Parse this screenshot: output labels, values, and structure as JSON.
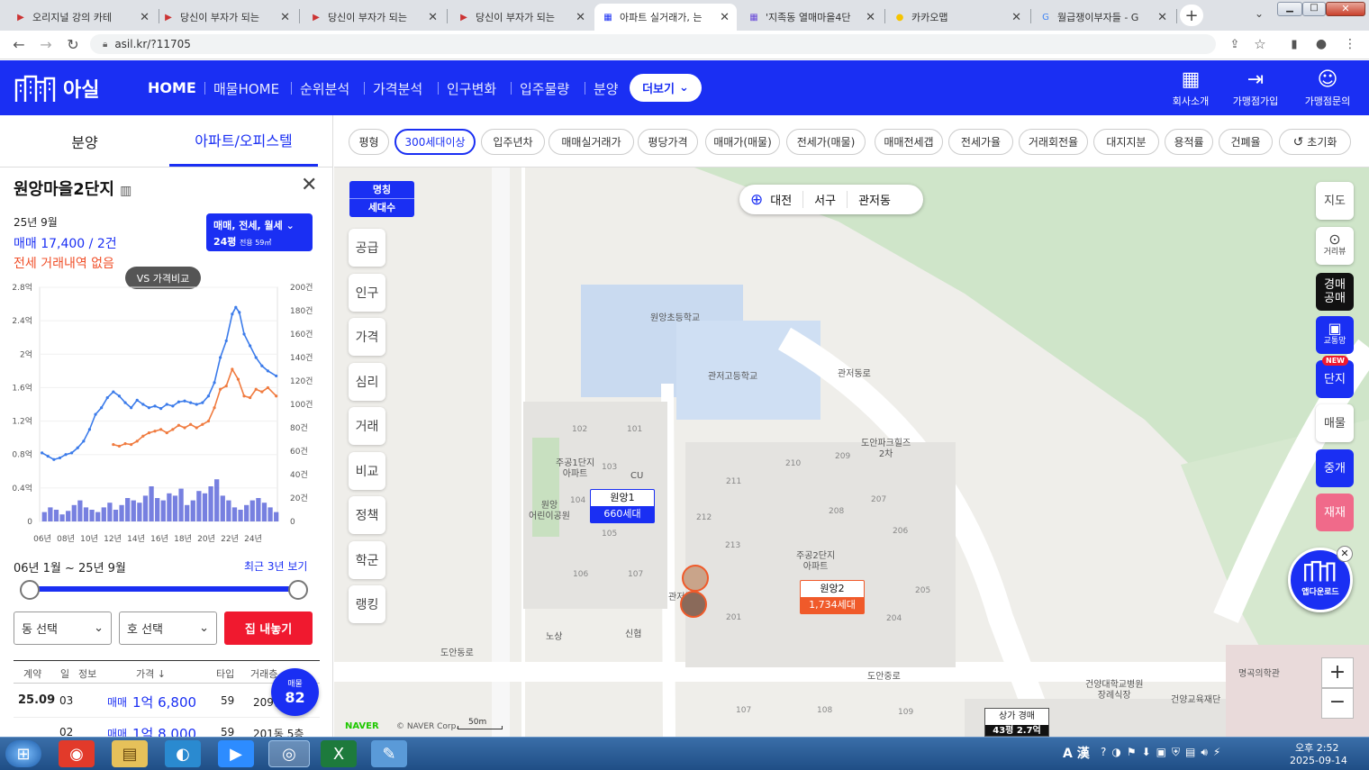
{
  "browser": {
    "tabs": [
      {
        "title": "오리지널 강의 카테",
        "icon": "flag"
      },
      {
        "title": "당신이 부자가 되는",
        "icon": "flag"
      },
      {
        "title": "당신이 부자가 되는",
        "icon": "flag"
      },
      {
        "title": "당신이 부자가 되는",
        "icon": "flag"
      },
      {
        "title": "아파트 실거래가, 는",
        "icon": "asil"
      },
      {
        "title": "'지족동 열매마을4단",
        "icon": "asil2"
      },
      {
        "title": "카카오맵",
        "icon": "kakao"
      },
      {
        "title": "월급쟁이부자들 - G",
        "icon": "google"
      }
    ],
    "url": "asil.kr/?11705"
  },
  "app": {
    "logo": "아실",
    "menu": [
      "HOME",
      "매물HOME",
      "순위분석",
      "가격분석",
      "인구변화",
      "입주물량",
      "분양"
    ],
    "more_btn": "더보기",
    "right_tools": [
      "회사소개",
      "가맹점가입",
      "가맹점문의"
    ]
  },
  "left": {
    "tabs": [
      "분양",
      "아파트/오피스텔"
    ],
    "apt_name": "원앙마을2단지",
    "date": "25년 9월",
    "sale_line": "매매 17,400 / 2건",
    "jeonse_line": "전세 거래내역 없음",
    "trade_box_title": "매매, 전세, 월세",
    "trade_box_size": "24평",
    "trade_box_sub": "전용 59㎡",
    "vs_btn": "VS 가격비교",
    "range_text": "06년 1월 ~ 25년 9월",
    "recent_link": "최근 3년 보기",
    "dong_select": "동 선택",
    "ho_select": "호 선택",
    "list_btn": "집 내놓기",
    "table_headers": [
      "계약",
      "일",
      "정보",
      "가격",
      "타입",
      "거래층"
    ],
    "rows": [
      {
        "ym": "25.09",
        "d": "03",
        "kind": "매매",
        "price": "1억 6,800",
        "type": "59",
        "floor": "209동"
      },
      {
        "ym": "",
        "d": "02",
        "kind": "매매",
        "price": "1억 8,000",
        "type": "59",
        "floor": "201동 5층"
      }
    ],
    "listing_badge_label": "매물",
    "listing_badge_count": "82"
  },
  "chart_data": {
    "type": "line",
    "x_ticks": [
      "06년",
      "08년",
      "10년",
      "12년",
      "14년",
      "16년",
      "18년",
      "20년",
      "22년",
      "24년"
    ],
    "y_left_ticks": [
      "2.8억",
      "2.4억",
      "2억",
      "1.6억",
      "1.2억",
      "0.8억",
      "0.4억",
      "0"
    ],
    "y_right_ticks": [
      "200건",
      "180건",
      "160건",
      "140건",
      "120건",
      "100건",
      "80건",
      "60건",
      "40건",
      "20건",
      "0"
    ],
    "ylim_left": [
      0,
      2.8
    ],
    "ylim_right": [
      0,
      200
    ],
    "colors": {
      "sale": "#3b7bea",
      "jeonse": "#f07b3f",
      "volume": "#5560d8"
    },
    "series": [
      {
        "key": "sale",
        "x": [
          2006.0,
          2006.5,
          2007.0,
          2007.5,
          2008.0,
          2008.5,
          2009.0,
          2009.5,
          2010.0,
          2010.5,
          2011.0,
          2011.5,
          2012.0,
          2012.5,
          2013.0,
          2013.5,
          2014.0,
          2014.5,
          2015.0,
          2015.5,
          2016.0,
          2016.5,
          2017.0,
          2017.5,
          2018.0,
          2018.5,
          2019.0,
          2019.5,
          2020.0,
          2020.5,
          2021.0,
          2021.5,
          2022.0,
          2022.3,
          2022.6,
          2023.0,
          2023.5,
          2024.0,
          2024.5,
          2025.0,
          2025.7
        ],
        "values": [
          0.82,
          0.78,
          0.74,
          0.76,
          0.8,
          0.82,
          0.88,
          0.96,
          1.1,
          1.28,
          1.36,
          1.48,
          1.55,
          1.5,
          1.42,
          1.36,
          1.45,
          1.4,
          1.36,
          1.38,
          1.35,
          1.4,
          1.38,
          1.43,
          1.44,
          1.42,
          1.4,
          1.42,
          1.5,
          1.66,
          1.96,
          2.16,
          2.48,
          2.56,
          2.5,
          2.24,
          2.1,
          1.96,
          1.86,
          1.8,
          1.74
        ]
      },
      {
        "key": "jeonse",
        "x": [
          2012.0,
          2012.5,
          2013.0,
          2013.5,
          2014.0,
          2014.5,
          2015.0,
          2015.5,
          2016.0,
          2016.5,
          2017.0,
          2017.5,
          2018.0,
          2018.5,
          2019.0,
          2019.5,
          2020.0,
          2020.5,
          2021.0,
          2021.5,
          2022.0,
          2022.5,
          2023.0,
          2023.5,
          2024.0,
          2024.5,
          2025.0,
          2025.7
        ],
        "values": [
          0.92,
          0.9,
          0.93,
          0.92,
          0.96,
          1.02,
          1.06,
          1.08,
          1.1,
          1.06,
          1.1,
          1.15,
          1.12,
          1.16,
          1.12,
          1.16,
          1.2,
          1.36,
          1.58,
          1.62,
          1.82,
          1.7,
          1.5,
          1.48,
          1.58,
          1.55,
          1.6,
          1.5
        ]
      }
    ],
    "volume": {
      "x": [
        2006.0,
        2006.5,
        2007.0,
        2007.5,
        2008.0,
        2008.5,
        2009.0,
        2009.5,
        2010.0,
        2010.5,
        2011.0,
        2011.5,
        2012.0,
        2012.5,
        2013.0,
        2013.5,
        2014.0,
        2014.5,
        2015.0,
        2015.5,
        2016.0,
        2016.5,
        2017.0,
        2017.5,
        2018.0,
        2018.5,
        2019.0,
        2019.5,
        2020.0,
        2020.5,
        2021.0,
        2021.5,
        2022.0,
        2022.5,
        2023.0,
        2023.5,
        2024.0,
        2024.5,
        2025.0,
        2025.5
      ],
      "values": [
        8,
        12,
        10,
        6,
        9,
        14,
        18,
        12,
        10,
        8,
        12,
        16,
        10,
        14,
        20,
        18,
        16,
        22,
        30,
        20,
        18,
        24,
        22,
        28,
        14,
        18,
        26,
        24,
        30,
        36,
        22,
        18,
        12,
        10,
        14,
        18,
        20,
        16,
        12,
        8
      ]
    }
  },
  "filters": [
    "평형",
    "300세대이상",
    "입주년차",
    "매매실거래가",
    "평당가격",
    "매매가(매물)",
    "전세가(매물)",
    "매매전세갭",
    "전세가율",
    "거래회전율",
    "대지지분",
    "용적률",
    "건폐율",
    "초기화"
  ],
  "map": {
    "legend_top": "명칭",
    "legend_bottom": "세대수",
    "breadcrumb": [
      "대전",
      "서구",
      "관저동"
    ],
    "left_btns": [
      "공급",
      "인구",
      "가격",
      "심리",
      "거래",
      "비교",
      "정책",
      "학군",
      "랭킹"
    ],
    "right_btns": [
      "지도",
      "거리뷰",
      "경매\n공매",
      "교통망",
      "단지",
      "매물",
      "중개",
      "재재"
    ],
    "new_tag": "NEW",
    "app_dl": "앱다운로드",
    "markers": [
      {
        "name": "원앙1",
        "units": "660세대"
      },
      {
        "name": "원앙2",
        "units": "1,734세대"
      }
    ],
    "places": [
      "원앙초등학교",
      "관저고등학교",
      "도안파크힐즈\n2차",
      "주공1단지\n아파트",
      "주공2단지\n아파트",
      "원앙\n어린이공원",
      "노상",
      "신협",
      "건양대학교병원\n장례식장",
      "건양교육재단",
      "명곡의학관",
      "CU",
      "상가 경매",
      "43평 2.7억",
      "도안동로",
      "도안중로",
      "관저북로",
      "관저동로"
    ],
    "blocks": [
      "102",
      "101",
      "103",
      "104",
      "105",
      "106",
      "107",
      "210",
      "209",
      "211",
      "212",
      "213",
      "208",
      "207",
      "206",
      "205",
      "204",
      "201",
      "107",
      "108",
      "109"
    ],
    "naver": "NAVER",
    "copyright": "© NAVER Corp.",
    "scale": "50m"
  },
  "taskbar": {
    "time": "오후 2:52",
    "date": "2025-09-14",
    "ime": "A 漢"
  }
}
